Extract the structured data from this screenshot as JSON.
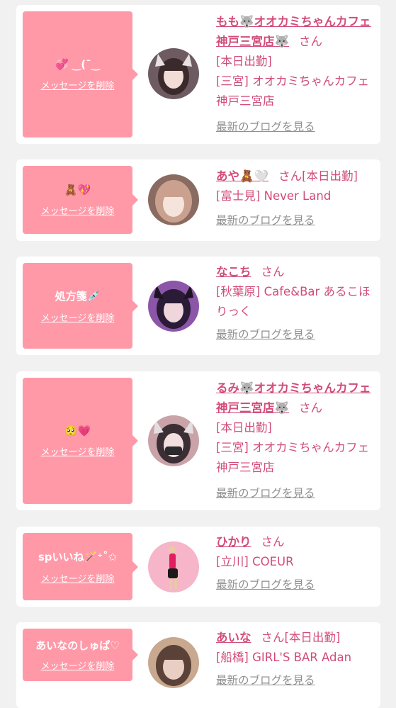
{
  "entries": [
    {
      "message": "💞 ‿(¯‿",
      "delete_label": "メッセージを削除",
      "name": "もも🐺オオカミちゃんカフェ神戸三宮店🐺",
      "san": "さん",
      "status": "[本日出勤]",
      "shop": "[三宮] オオカミちゃんカフェ神戸三宮店",
      "blog_label": "最新のブログを見る",
      "avatar_colors": [
        "#3a2a2c",
        "#f1ddd6",
        "#6e5b61"
      ]
    },
    {
      "message": "🧸💖",
      "delete_label": "メッセージを削除",
      "name": "あや🧸🤍",
      "san": "さん",
      "status": "[本日出勤]",
      "shop": "[富士見] Never Land",
      "blog_label": "最新のブログを見る",
      "avatar_colors": [
        "#caa18e",
        "#f4e4dc",
        "#8a6b61"
      ]
    },
    {
      "message": "処方箋💉",
      "delete_label": "メッセージを削除",
      "name": "なこち",
      "san": "さん",
      "status": "",
      "shop": "[秋葉原] Cafe&Bar あるこほりっく",
      "blog_label": "最新のブログを見る",
      "avatar_colors": [
        "#2a1b36",
        "#efd6dd",
        "#8b55a8"
      ]
    },
    {
      "message": "🥺💗",
      "delete_label": "メッセージを削除",
      "name": "るみ🐺オオカミちゃんカフェ神戸三宮店🐺",
      "san": "さん",
      "status": "[本日出勤]",
      "shop": "[三宮] オオカミちゃんカフェ神戸三宮店",
      "blog_label": "最新のブログを見る",
      "avatar_colors": [
        "#3b2f35",
        "#f3dfe0",
        "#c9a3a8"
      ]
    },
    {
      "message": "spいいね🪄⁺˚✩",
      "delete_label": "メッセージを削除",
      "name": "ひかり",
      "san": "さん",
      "status": "",
      "shop": "[立川] COEUR",
      "blog_label": "最新のブログを見る",
      "avatar_colors": [
        "#f6b5c8",
        "#e21e63",
        "#1a1a1a"
      ]
    },
    {
      "message": "あいなのしゅぱ♡",
      "delete_label": "メッセージを削除",
      "name": "あいな",
      "san": "さん",
      "status": "[本日出勤]",
      "shop": "[船橋] GIRL'S BAR Adan",
      "blog_label": "最新のブログを見る",
      "avatar_colors": [
        "#5b4238",
        "#e9cfc3",
        "#c8a88f"
      ]
    }
  ]
}
